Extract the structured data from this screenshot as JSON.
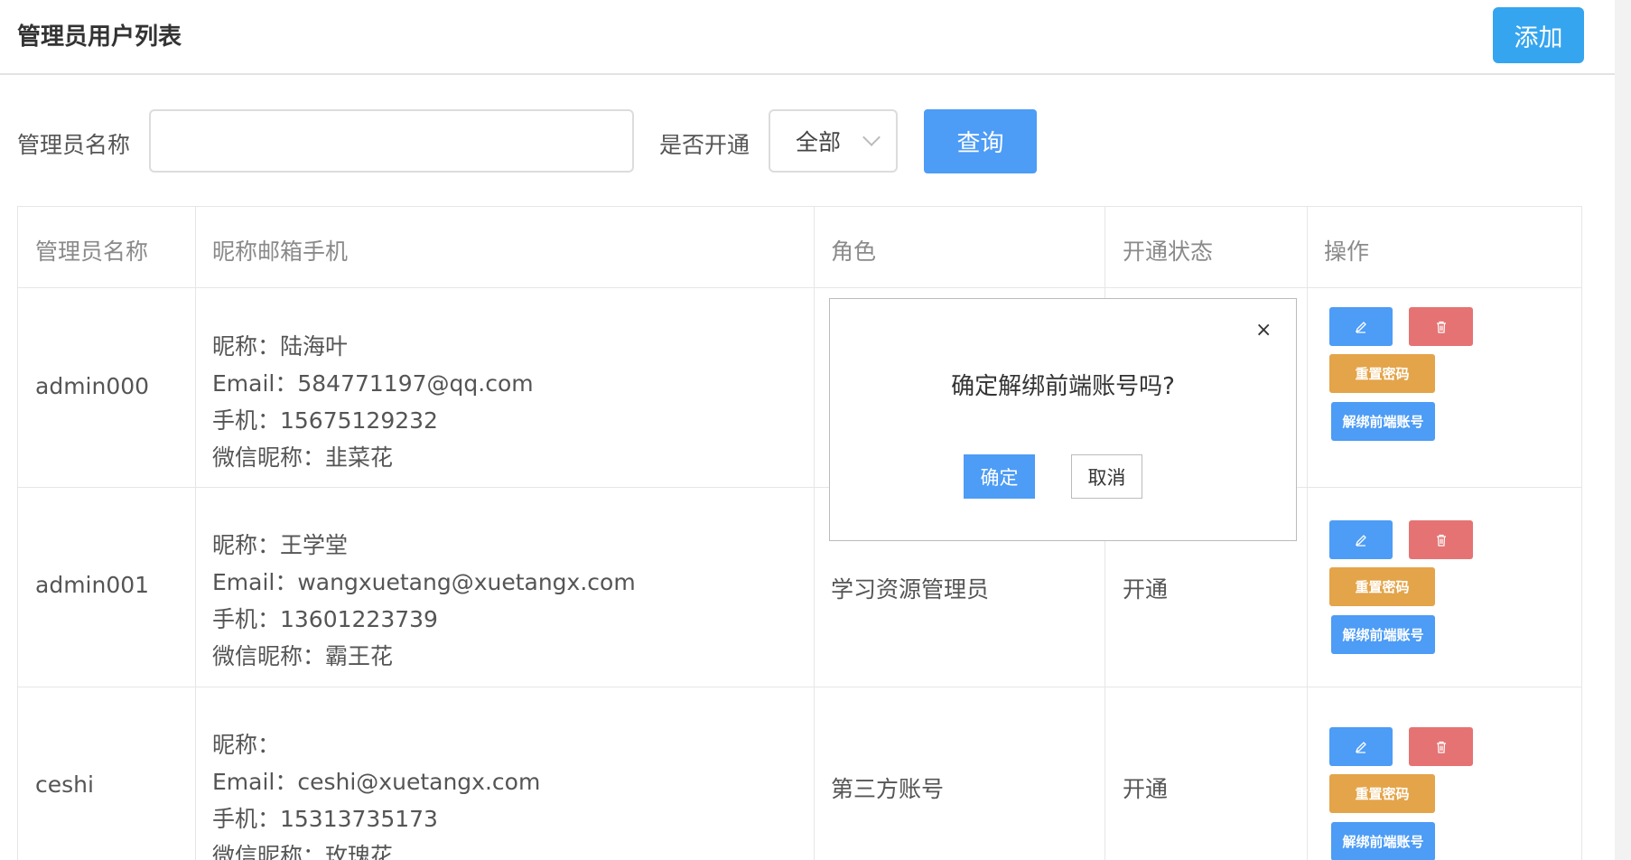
{
  "header": {
    "title": "管理员用户列表",
    "add_label": "添加"
  },
  "filters": {
    "name_label": "管理员名称",
    "name_value": "",
    "name_placeholder": "",
    "status_label": "是否开通",
    "status_selected": "全部",
    "query_label": "查询"
  },
  "table": {
    "headers": [
      "管理员名称",
      "昵称邮箱手机",
      "角色",
      "开通状态",
      "操作"
    ],
    "rows": [
      {
        "name": "admin000",
        "nickname_line": "昵称：陆海叶",
        "email_line": "Email：584771197@qq.com",
        "phone_line": "手机：15675129232",
        "wechat_line": "微信昵称：韭菜花",
        "role": "",
        "status": ""
      },
      {
        "name": "admin001",
        "nickname_line": "昵称：王学堂",
        "email_line": "Email：wangxuetang@xuetangx.com",
        "phone_line": "手机：13601223739",
        "wechat_line": "微信昵称：霸王花",
        "role": "学习资源管理员",
        "status": "开通"
      },
      {
        "name": "ceshi",
        "nickname_line": "昵称：",
        "email_line": "Email：ceshi@xuetangx.com",
        "phone_line": "手机：15313735173",
        "wechat_line": "微信昵称：玫瑰花",
        "role": "第三方账号",
        "status": "开通"
      }
    ],
    "actions": {
      "edit_icon": "pencil-icon",
      "delete_icon": "trash-icon",
      "reset_label": "重置密码",
      "unbind_label": "解绑前端账号"
    }
  },
  "popup": {
    "message": "确定解绑前端账号吗?",
    "close_label": "×",
    "confirm_label": "确定",
    "cancel_label": "取消"
  },
  "colors": {
    "primary": "#4d9cf5",
    "add_button": "#35a5ef",
    "delete": "#e57373",
    "reset": "#e4a44a"
  }
}
